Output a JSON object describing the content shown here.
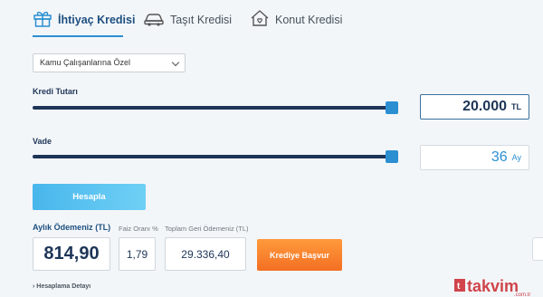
{
  "tabs": [
    {
      "label": "İhtiyaç Kredisi",
      "icon": "gift-icon",
      "active": true
    },
    {
      "label": "Taşıt Kredisi",
      "icon": "car-icon",
      "active": false
    },
    {
      "label": "Konut Kredisi",
      "icon": "house-icon",
      "active": false
    }
  ],
  "segment": {
    "selected": "Kamu Çalışanlarına Özel"
  },
  "loan_amount": {
    "label": "Kredi Tutarı",
    "value": "20.000",
    "unit": "TL",
    "slider_level": 1.0
  },
  "term": {
    "label": "Vade",
    "value": "36",
    "unit": "Ay",
    "slider_level": 1.0
  },
  "calculate_label": "Hesapla",
  "results": {
    "monthly_label": "Aylık Ödemeniz (TL)",
    "monthly_value": "814,90",
    "rate_label": "Faiz Oranı %",
    "rate_value": "1,79",
    "total_label": "Toplam Geri Ödemeniz (TL)",
    "total_value": "29.336,40"
  },
  "apply_label": "Krediye Başvur",
  "detail_link": "Hesaplama Detayı",
  "watermark": {
    "text": "takvim",
    "domain": ".com.tr"
  },
  "colors": {
    "accent": "#2b8fd1",
    "navy": "#1d3557",
    "orange": "#f36f23",
    "watermark_red": "#c9252c"
  }
}
